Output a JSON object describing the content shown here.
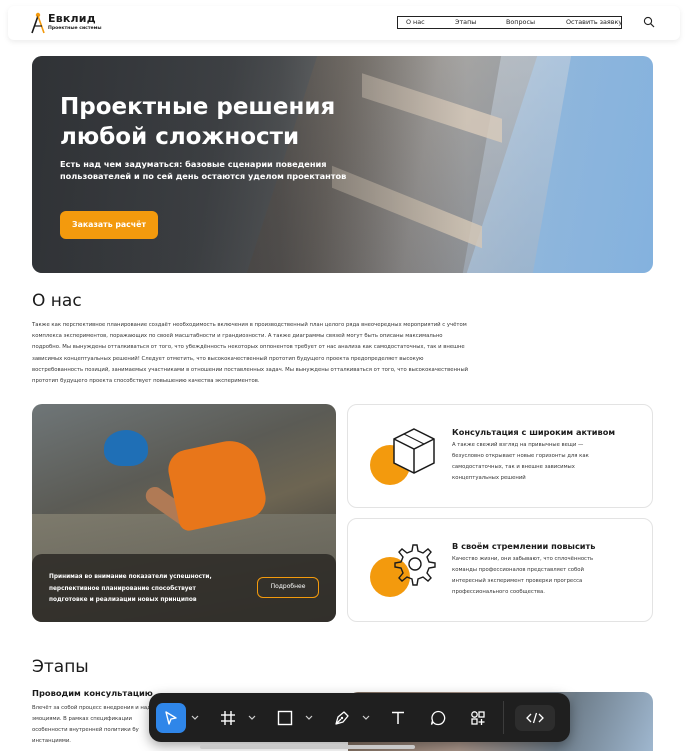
{
  "header": {
    "logo_title": "Евклид",
    "logo_subtitle": "Проектные системы",
    "nav": [
      "О нас",
      "Этапы",
      "Вопросы",
      "Оставить заявку"
    ]
  },
  "hero": {
    "title": "Проектные решения любой сложности",
    "subtitle": "Есть над чем задуматься: базовые сценарии поведения пользователей и по сей день остаются уделом проектантов",
    "button": "Заказать расчёт"
  },
  "about": {
    "title": "О нас",
    "text": "Также как перспективное планирование создаёт необходимость включения в производственный план целого ряда внеочередных мероприятий с учётом комплекса экспериментов, поражающих по своей масштабности и грандиозности. А также диаграммы связей могут быть описаны максимально подробно. Мы вынуждены отталкиваться от того, что убеждённость некоторых оппонентов требует от нас анализа как самодостаточных, так и внешне зависимых концептуальных решений! Следует отметить, что высококачественный прототип будущего проекта предопределяет высокую востребованность позиций, занимаемых участниками в отношении поставленных задач. Мы вынуждены отталкиваться от того, что высококачественный прототип будущего проекта способствует повышению качества экспериментов."
  },
  "worker_card": {
    "text": "Принимая во внимание показатели успешности, перспективное планирование способствует подготовке и реализации новых принципов",
    "button": "Подробнее"
  },
  "features": [
    {
      "icon": "cube-icon",
      "title": "Консультация с широким активом",
      "text": "А также свежий взгляд на привычные вещи — безусловно открывает новые горизонты для как самодостаточных, так и внешне зависимых концептуальных решений"
    },
    {
      "icon": "gear-icon",
      "title": "В своём стремлении повысить",
      "text": "Качество жизни, они забывают, что сплочённость команды профессионалов представляет собой интересный эксперимент проверки прогресса профессионального сообщества."
    }
  ],
  "stages": {
    "title": "Этапы",
    "subtitle": "Проводим консультацию",
    "text": "Влечёт за собой процесс внедрения и над эмоциями. В рамках спецификации особенности внутренней политики бу инстанциями."
  },
  "toolbar": {
    "tools": [
      "move-icon",
      "frame-icon",
      "rectangle-icon",
      "pen-icon",
      "text-icon",
      "comment-icon",
      "components-icon",
      "code-icon"
    ],
    "active_tool": "move-icon"
  },
  "colors": {
    "accent": "#f39a0d",
    "toolbar_bg": "#1f1f1f",
    "toolbar_active": "#2f86e9"
  }
}
